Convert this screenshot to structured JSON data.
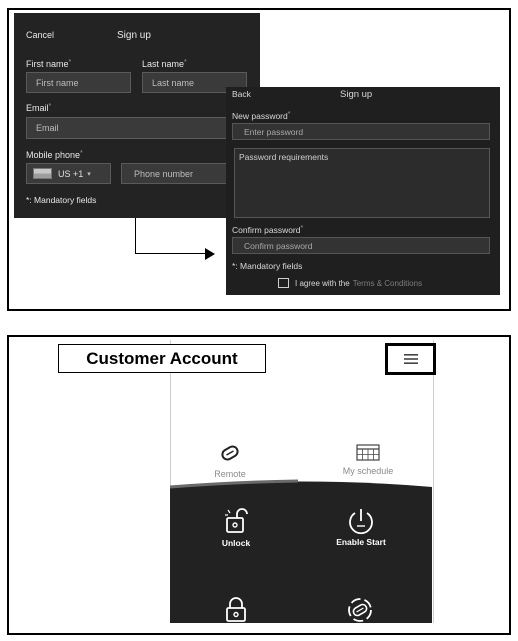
{
  "signup1": {
    "cancel": "Cancel",
    "title": "Sign up",
    "first_name_label": "First name",
    "first_name_placeholder": "First name",
    "last_name_label": "Last name",
    "last_name_placeholder": "Last name",
    "email_label": "Email",
    "email_placeholder": "Email",
    "mobile_label": "Mobile phone",
    "country_code": "US +1",
    "phone_placeholder": "Phone number",
    "mandatory_note": "*: Mandatory fields",
    "required_mark": "*"
  },
  "signup2": {
    "back": "Back",
    "title": "Sign up",
    "new_password_label": "New password",
    "new_password_placeholder": "Enter password",
    "requirements_label": "Password requirements",
    "confirm_password_label": "Confirm password",
    "confirm_password_placeholder": "Confirm password",
    "mandatory_note": "*: Mandatory fields",
    "agree_prefix": "I agree with the",
    "terms_link": "Terms & Conditions",
    "required_mark": "*"
  },
  "account": {
    "label": "Customer Account",
    "tabs": [
      {
        "label": "Remote",
        "icon": "remote-icon"
      },
      {
        "label": "My schedule",
        "icon": "calendar-icon"
      }
    ],
    "actions": [
      {
        "label": "Unlock",
        "icon": "unlock-icon"
      },
      {
        "label": "Enable Start",
        "icon": "power-icon"
      },
      {
        "label": "",
        "icon": "lock-icon"
      },
      {
        "label": "",
        "icon": "remote-start-icon"
      }
    ]
  },
  "colors": {
    "dark_bg": "#232323",
    "field_bg": "#3a3a3a",
    "accent_line": "#555555"
  }
}
